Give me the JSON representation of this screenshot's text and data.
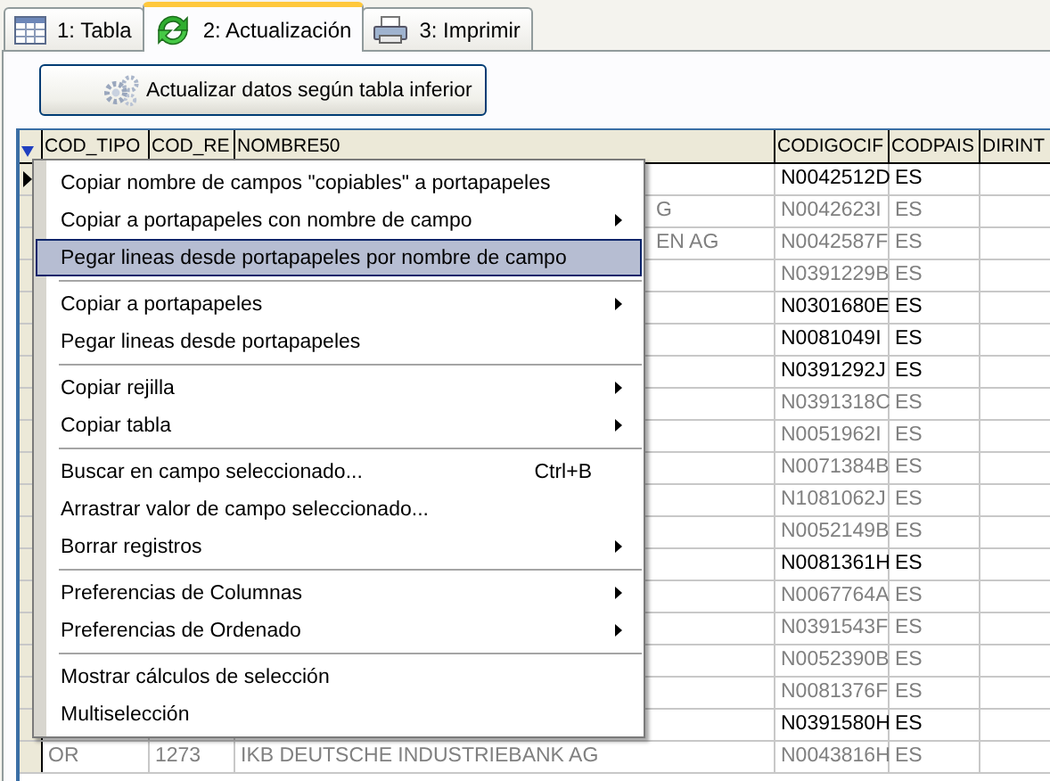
{
  "tabs": [
    {
      "label": "1: Tabla",
      "kind": "table",
      "selected": false
    },
    {
      "label": "2: Actualización",
      "kind": "refresh",
      "selected": true
    },
    {
      "label": "3: Imprimir",
      "kind": "printer",
      "selected": false
    }
  ],
  "update_button": {
    "label": "Actualizar datos según tabla inferior"
  },
  "grid": {
    "columns": [
      {
        "label": "COD_TIPO"
      },
      {
        "label": "COD_RE"
      },
      {
        "label": "NOMBRE50"
      },
      {
        "label": "CODIGOCIF"
      },
      {
        "label": "CODPAIS"
      },
      {
        "label": "DIRINT"
      }
    ],
    "rows": [
      {
        "current": true,
        "dimmed": false,
        "codigocif": "N0042512D",
        "codpais": "ES"
      },
      {
        "current": false,
        "dimmed": true,
        "nombre50": "G",
        "codigocif": "N0042623I",
        "codpais": "ES"
      },
      {
        "current": false,
        "dimmed": true,
        "nombre50": "EN AG",
        "codigocif": "N0042587F",
        "codpais": "ES"
      },
      {
        "current": false,
        "dimmed": true,
        "codigocif": "N0391229B",
        "codpais": "ES"
      },
      {
        "current": false,
        "dimmed": false,
        "codigocif": "N0301680E",
        "codpais": "ES"
      },
      {
        "current": false,
        "dimmed": false,
        "codigocif": "N0081049I",
        "codpais": "ES"
      },
      {
        "current": false,
        "dimmed": false,
        "codigocif": "N0391292J",
        "codpais": "ES"
      },
      {
        "current": false,
        "dimmed": true,
        "codigocif": "N0391318C",
        "codpais": "ES"
      },
      {
        "current": false,
        "dimmed": true,
        "codigocif": "N0051962I",
        "codpais": "ES"
      },
      {
        "current": false,
        "dimmed": true,
        "codigocif": "N0071384B",
        "codpais": "ES"
      },
      {
        "current": false,
        "dimmed": true,
        "codigocif": "N1081062J",
        "codpais": "ES"
      },
      {
        "current": false,
        "dimmed": true,
        "codigocif": "N0052149B",
        "codpais": "ES"
      },
      {
        "current": false,
        "dimmed": false,
        "codigocif": "N0081361H",
        "codpais": "ES"
      },
      {
        "current": false,
        "dimmed": true,
        "codigocif": "N0067764A",
        "codpais": "ES"
      },
      {
        "current": false,
        "dimmed": true,
        "codigocif": "N0391543F",
        "codpais": "ES"
      },
      {
        "current": false,
        "dimmed": true,
        "codigocif": "N0052390B",
        "codpais": "ES"
      },
      {
        "current": false,
        "dimmed": true,
        "codigocif": "N0081376F",
        "codpais": "ES"
      },
      {
        "current": false,
        "dimmed": false,
        "codigocif": "N0391580H",
        "codpais": "ES"
      },
      {
        "current": false,
        "dimmed": true,
        "cod_tipo": "OR",
        "cod_re": "1273",
        "nombre50": "IKB DEUTSCHE INDUSTRIEBANK AG",
        "codigocif": "N0043816H",
        "codpais": "ES"
      }
    ]
  },
  "context_menu": {
    "items": [
      {
        "kind": "item",
        "label": "Copiar nombre de campos \"copiables\" a portapapeles",
        "submenu": false,
        "selected": false
      },
      {
        "kind": "item",
        "label": "Copiar a portapapeles con nombre de campo",
        "submenu": true,
        "selected": false
      },
      {
        "kind": "item",
        "label": "Pegar lineas desde portapapeles por nombre de campo",
        "submenu": false,
        "selected": true
      },
      {
        "kind": "separator"
      },
      {
        "kind": "item",
        "label": "Copiar a portapapeles",
        "submenu": true,
        "selected": false
      },
      {
        "kind": "item",
        "label": "Pegar lineas desde portapapeles",
        "submenu": false,
        "selected": false
      },
      {
        "kind": "separator"
      },
      {
        "kind": "item",
        "label": "Copiar rejilla",
        "submenu": true,
        "selected": false
      },
      {
        "kind": "item",
        "label": "Copiar tabla",
        "submenu": true,
        "selected": false
      },
      {
        "kind": "separator"
      },
      {
        "kind": "item",
        "label": "Buscar en campo seleccionado...",
        "shortcut": "Ctrl+B",
        "submenu": false,
        "selected": false
      },
      {
        "kind": "item",
        "label": "Arrastrar valor de campo seleccionado...",
        "submenu": false,
        "selected": false
      },
      {
        "kind": "item",
        "label": "Borrar registros",
        "submenu": true,
        "selected": false
      },
      {
        "kind": "separator"
      },
      {
        "kind": "item",
        "label": "Preferencias de Columnas",
        "submenu": true,
        "selected": false
      },
      {
        "kind": "item",
        "label": "Preferencias de Ordenado",
        "submenu": true,
        "selected": false
      },
      {
        "kind": "separator"
      },
      {
        "kind": "item",
        "label": "Mostrar cálculos de selección",
        "submenu": false,
        "selected": false
      },
      {
        "kind": "item",
        "label": "Multiselección",
        "submenu": false,
        "selected": false
      }
    ]
  }
}
